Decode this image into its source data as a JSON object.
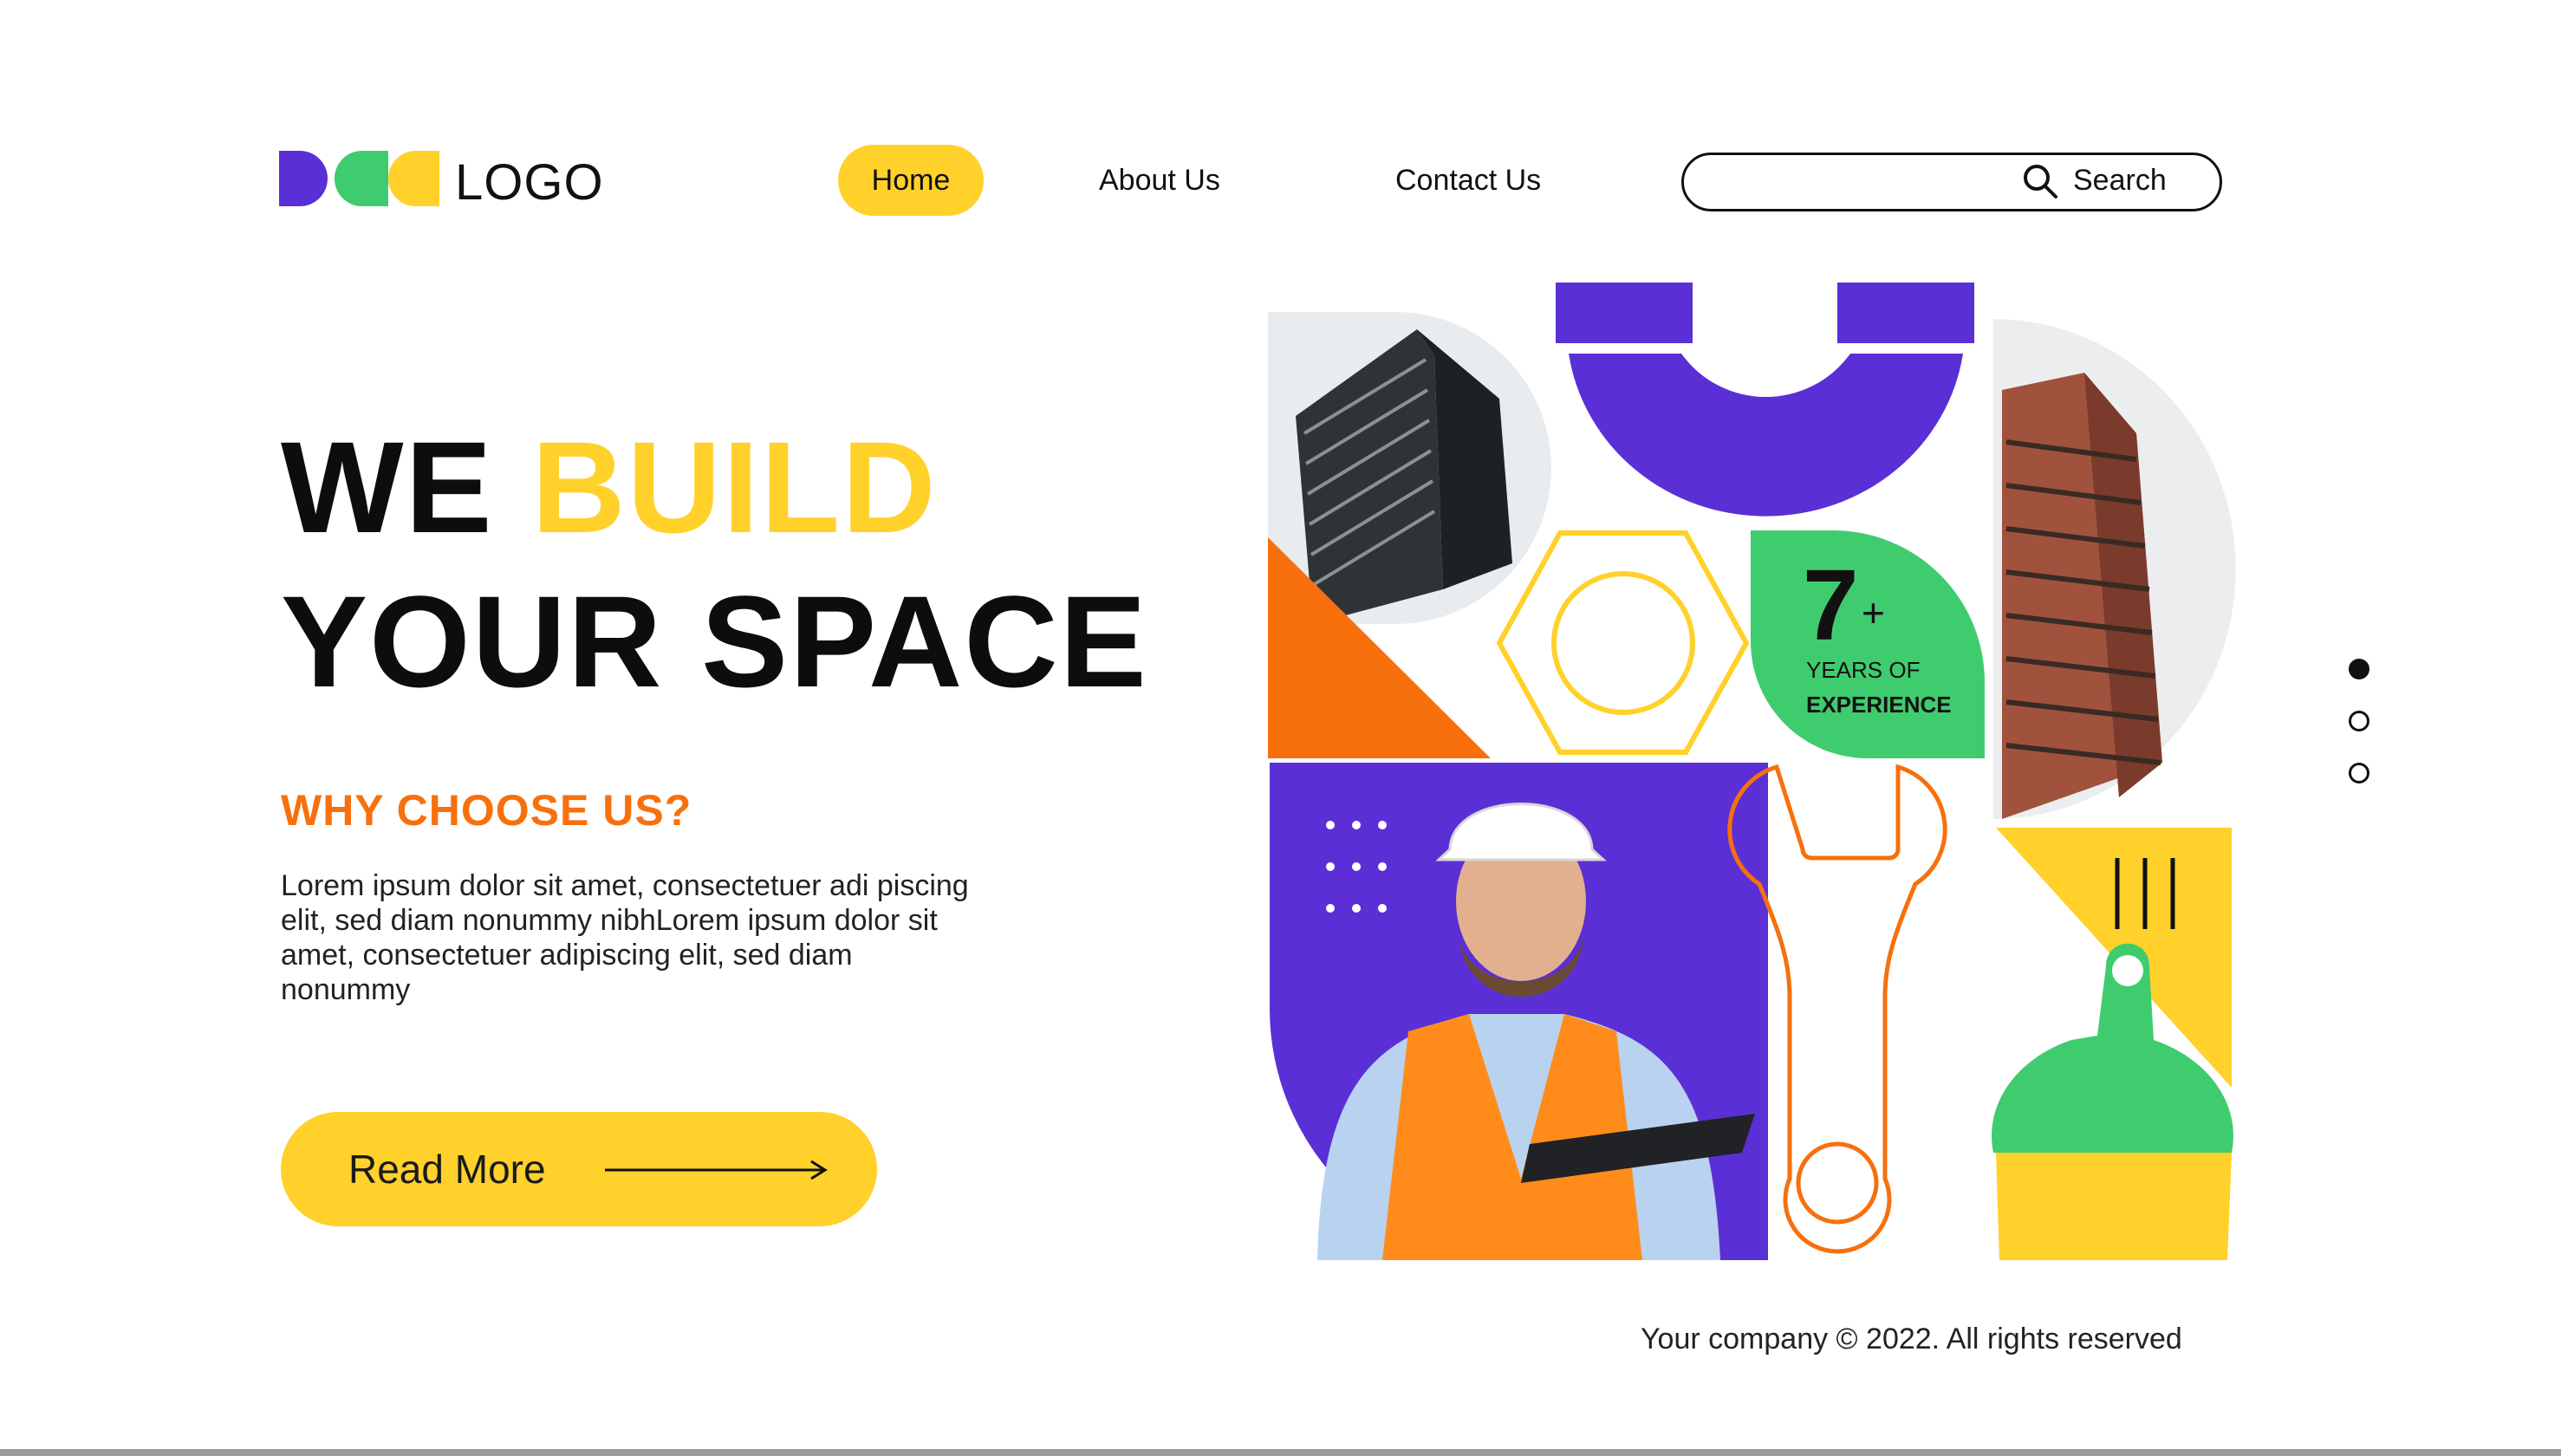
{
  "header": {
    "logo_text": "LOGO",
    "nav": {
      "home": "Home",
      "about": "About Us",
      "contact": "Contact Us"
    },
    "search": {
      "label": "Search",
      "placeholder": ""
    }
  },
  "hero": {
    "title_word1": "WE",
    "title_word2": "BUILD",
    "title_line2": "YOUR SPACE",
    "subtitle": "WHY CHOOSE US?",
    "body": "Lorem ipsum dolor sit amet, consectetuer adi piscing elit, sed diam nonummy nibhLorem ipsum dolor sit amet, consectetuer adipiscing elit, sed diam nonummy",
    "cta_label": "Read More"
  },
  "badge": {
    "number": "7",
    "plus": "+",
    "line1": "YEARS OF",
    "line2": "EXPERIENCE"
  },
  "pager": {
    "total": 3,
    "active": 1
  },
  "footer": {
    "copyright": "Your company © 2022. All rights reserved"
  },
  "colors": {
    "yellow": "#FFD12A",
    "purple": "#5B2FD6",
    "green": "#3FCC6E",
    "orange": "#F7700D",
    "black": "#0d0d0d"
  },
  "icons": [
    "logo-mark-icon",
    "search-icon",
    "arrow-right-icon",
    "hexagon-nut-icon",
    "wrench-icon",
    "scraper-icon"
  ]
}
